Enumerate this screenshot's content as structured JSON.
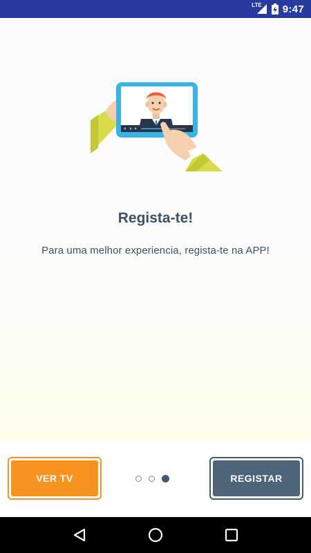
{
  "status_bar": {
    "network": "LTE",
    "time": "9:47",
    "icons": [
      "signal-icon",
      "battery-charging-icon"
    ]
  },
  "onboarding": {
    "title": "Regista-te!",
    "subtitle": "Para uma melhor experiencia, regista-te na APP!",
    "illustration": "tablet-video-illustration"
  },
  "actions": {
    "left_label": "VER TV",
    "right_label": "REGISTAR"
  },
  "pager": {
    "total": 3,
    "active_index": 2
  },
  "colors": {
    "status_bar": "#273a9e",
    "accent_orange": "#f7931e",
    "primary_slate": "#4e6479",
    "text": "#3b5266"
  },
  "nav_bar": {
    "icons": [
      "back-icon",
      "home-icon",
      "recents-icon"
    ]
  }
}
